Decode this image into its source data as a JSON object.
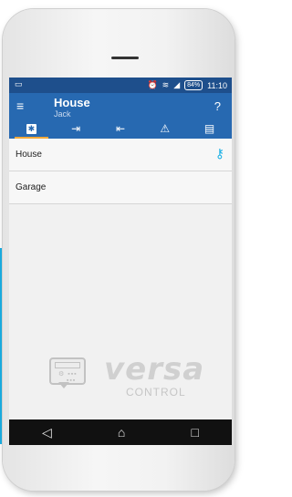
{
  "status_bar": {
    "battery": "84%",
    "time": "11:10",
    "icons": [
      "alarm-icon",
      "wifi-icon",
      "signal-icon"
    ]
  },
  "app_bar": {
    "title": "House",
    "subtitle": "Jack",
    "help": "?"
  },
  "tabs": [
    {
      "icon": "gear-icon",
      "active": true
    },
    {
      "icon": "login-icon",
      "active": false
    },
    {
      "icon": "logout-icon",
      "active": false
    },
    {
      "icon": "warning-icon",
      "active": false
    },
    {
      "icon": "list-icon",
      "active": false
    }
  ],
  "list": {
    "items": [
      {
        "label": "House",
        "icon": "key-icon"
      },
      {
        "label": "Garage"
      }
    ]
  },
  "logo": {
    "brand": "versa",
    "sub": "CONTROL"
  },
  "colors": {
    "app_bar": "#2769b1",
    "status_bar": "#1e4f8c",
    "tab_indicator": "#f2a93b",
    "key_icon": "#1ab0e5",
    "accent": "#1ab0e5"
  }
}
